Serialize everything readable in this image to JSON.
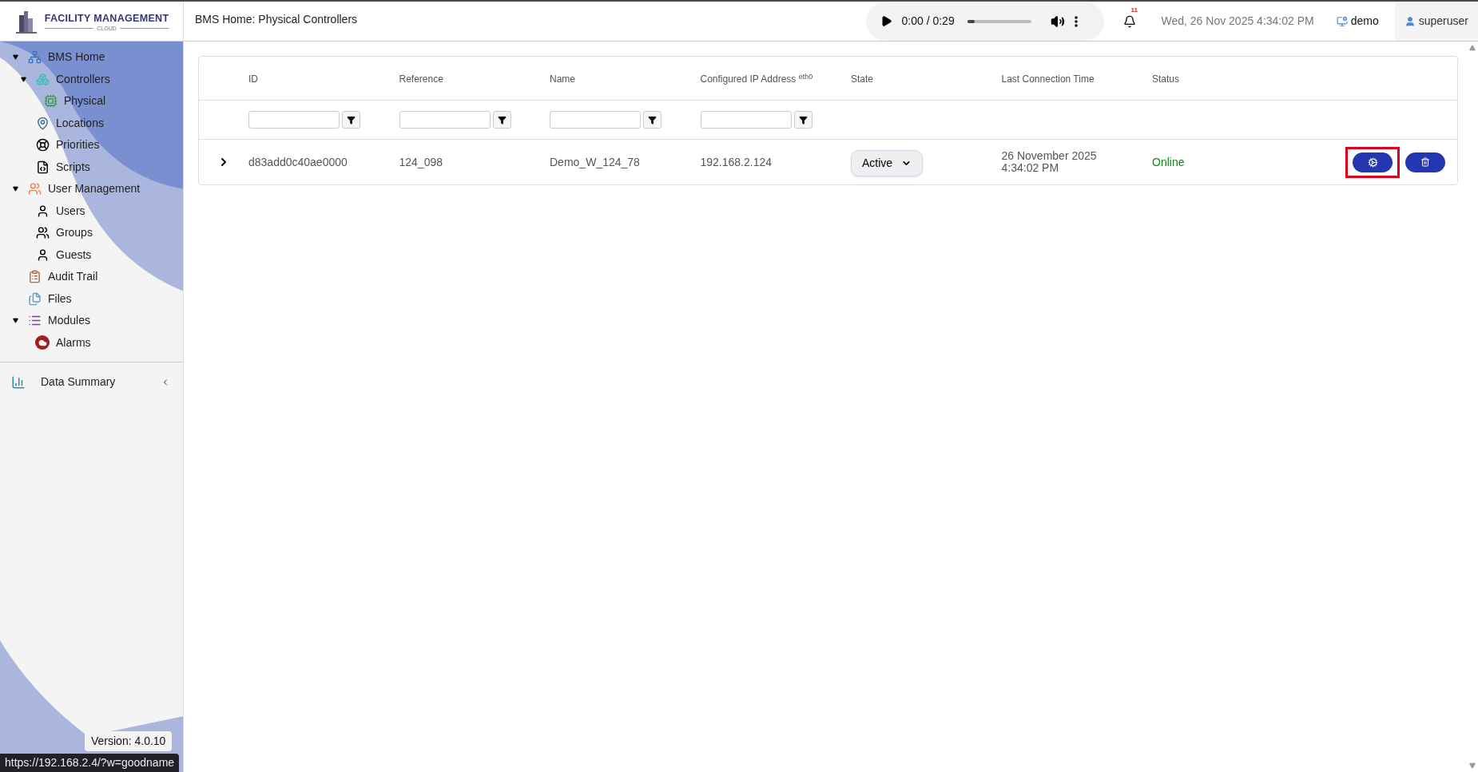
{
  "header": {
    "logo": {
      "title": "FACILITY MANAGEMENT",
      "subtitle": "CLOUD"
    },
    "page_title": "BMS Home: Physical Controllers",
    "player": {
      "time": "0:00 / 0:29",
      "level": 0.12
    },
    "notifications": {
      "count": "11"
    },
    "datetime": "Wed, 26 Nov 2025 4:34:02 PM",
    "site": "demo",
    "user": "superuser"
  },
  "sidebar": {
    "tree": [
      {
        "label": "BMS Home",
        "expanded": true,
        "children": [
          {
            "label": "Controllers",
            "expanded": true,
            "children": [
              {
                "label": "Physical"
              }
            ]
          },
          {
            "label": "Locations"
          },
          {
            "label": "Priorities"
          },
          {
            "label": "Scripts"
          }
        ]
      },
      {
        "label": "User Management",
        "expanded": true,
        "children": [
          {
            "label": "Users"
          },
          {
            "label": "Groups"
          },
          {
            "label": "Guests"
          }
        ]
      },
      {
        "label": "Audit Trail"
      },
      {
        "label": "Files"
      },
      {
        "label": "Modules",
        "expanded": true,
        "children": [
          {
            "label": "Alarms"
          }
        ]
      }
    ],
    "data_summary": {
      "label": "Data Summary",
      "expanded": false
    },
    "version": "Version: 4.0.10"
  },
  "table": {
    "columns": [
      {
        "label": "ID",
        "filter": true
      },
      {
        "label": "Reference",
        "filter": true
      },
      {
        "label": "Name",
        "filter": true
      },
      {
        "label": "Configured IP Address $^{eth0}$",
        "filter": true
      },
      {
        "label": "State",
        "filter": false
      },
      {
        "label": "Last Connection Time",
        "filter": false
      },
      {
        "label": "Status",
        "filter": false
      }
    ],
    "rows": [
      {
        "expanded": false,
        "id": "d83add0c40ae0000",
        "reference": "124_098",
        "name": "Demo_W_124_78",
        "ip": "192.168.2.124",
        "state": "Active",
        "last_connection": "26 November 2025\n4:34:02 PM",
        "status": "Online",
        "actions": [
          {
            "kind": "settings",
            "highlighted": true
          },
          {
            "kind": "delete",
            "highlighted": false
          }
        ]
      }
    ]
  },
  "status_url": "https://192.168.2.4/?w=goodname"
}
